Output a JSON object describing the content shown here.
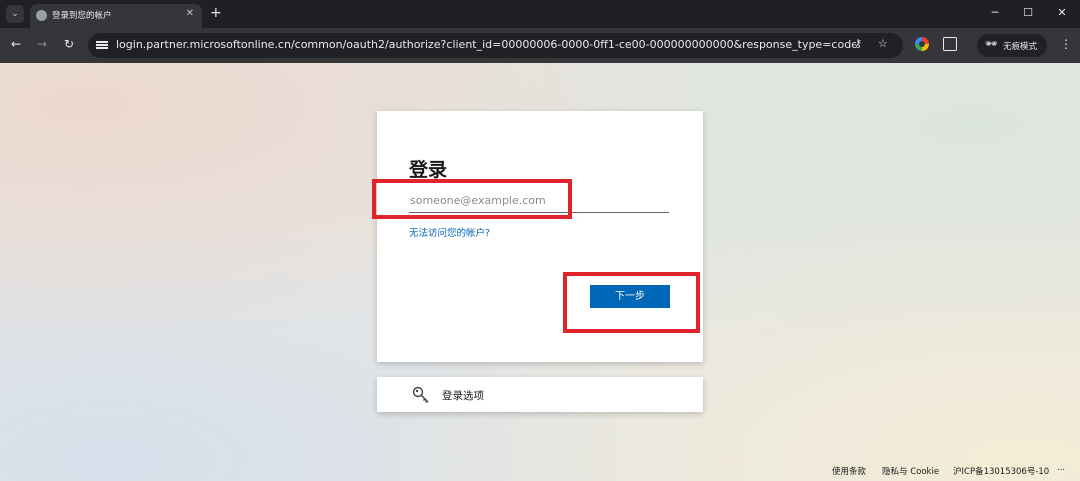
{
  "browser": {
    "tab_title": "登录到您的帐户",
    "url": "login.partner.microsoftonline.cn/common/oauth2/authorize?client_id=00000006-0000-0ff1-ce00-000000000000&response_type=code%20id_tok...",
    "incognito_label": "无痕模式"
  },
  "card": {
    "title": "登录",
    "email_placeholder": "someone@example.com",
    "cant_access_link": "无法访问您的帐户?",
    "next_button": "下一步"
  },
  "signin_options": {
    "label": "登录选项",
    "icon": "key-icon"
  },
  "footer": {
    "terms": "使用条款",
    "privacy": "隐私与 Cookie",
    "icp": "沪ICP备13015306号-10",
    "more": "..."
  },
  "highlights": {
    "color": "#e0242b",
    "targets": [
      "email-input",
      "next-button"
    ]
  },
  "colors": {
    "accent": "#0067b8",
    "chrome_dark": "#35363a"
  }
}
